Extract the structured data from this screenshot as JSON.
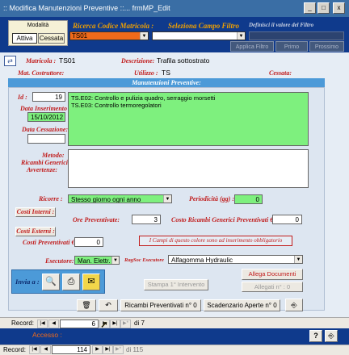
{
  "window": {
    "title": ":: Modifica Manutenzioni Preventive ::...   frmMP_Edit",
    "minimize": "_",
    "maximize": "□",
    "close": "x"
  },
  "header": {
    "filter_mode_label": "Modalità",
    "mode_attiva": "Attiva",
    "mode_cessata": "Cessata",
    "search_label": "Ricerca Codice Matricola :",
    "search_value": "TS01",
    "field_label": "Seleziona Campo Filtro",
    "define_label": "Definisci il valore del Filtro",
    "apply_filter": "Applica Filtro",
    "first": "Primo",
    "next": "Prossimo"
  },
  "info": {
    "matricola_label": "Matricola :",
    "matricola_value": "TS01",
    "descrizione_label": "Descrizione:",
    "descrizione_value": "Trafila sottostrato",
    "costruttore_label": "Mat. Costruttore:",
    "utilizzo_label": "Utilizzo :",
    "utilizzo_value": "TS",
    "cessata_label": "Cessata:"
  },
  "section": {
    "title": "Manutenzioni Preventive:"
  },
  "fields": {
    "id_label": "Id :",
    "id_value": "19",
    "data_ins_label": "Data Inserimento :",
    "data_ins_value": "15/10/2012",
    "data_cess_label": "Data Cessazione:",
    "tasks": [
      "TS.E02:   Controllo e pulizia quadro, serraggio morsetti",
      "TS.E03:   Controllo termoregolatori"
    ],
    "metodo_label": "Metodo:",
    "ricambi_label": "Ricambi Generici:",
    "avvertenze_label": "Avvertenze:",
    "ricorre_label": "Ricorre :",
    "ricorre_value": "Stesso giorno ogni anno",
    "periodicita_label": "Periodicità (gg) :",
    "periodicita_value": "0",
    "costi_interni_btn": "Costi Interni :",
    "ore_label": "Ore Preventivate:",
    "ore_value": "3",
    "costo_ricambi_label": "Costo Ricambi Generici Preventivati € :",
    "costo_ricambi_value": "0",
    "costi_esterni_btn": "Costi Esterni :",
    "costi_prev_label": "Costi Preventivati € :",
    "costi_prev_value": "0",
    "note_required": "I Campi di questo colore sono ad inserimento obbligatorio",
    "esecutore_label": "Esecutore:",
    "esecutore_value": "Man. Elettr.",
    "ragsoc_label": "RagSoc Esecutore",
    "ragsoc_value": "Alfagomma Hydraulic"
  },
  "actions": {
    "invia_label": "Invia a :",
    "stampa": "Stampa 1° Intervento",
    "allega": "Allega Documenti",
    "allegati": "Allegati n° : 0",
    "ricambi_prev": "Ricambi Preventivati n° 0",
    "scadenzario": "Scadenzario Aperte n° 0"
  },
  "subnav": {
    "label": "Record:",
    "current": "6",
    "of": "di 7"
  },
  "footer": {
    "accesso": "Accesso :"
  },
  "mainnav": {
    "label": "Record:",
    "current": "114",
    "of": "di 115"
  },
  "colors": {
    "header": "#0f3a8c",
    "titlebar": "#3a6ea5",
    "required": "#7ef07e",
    "label": "#c11c1c",
    "section": "#4c9ad8"
  }
}
